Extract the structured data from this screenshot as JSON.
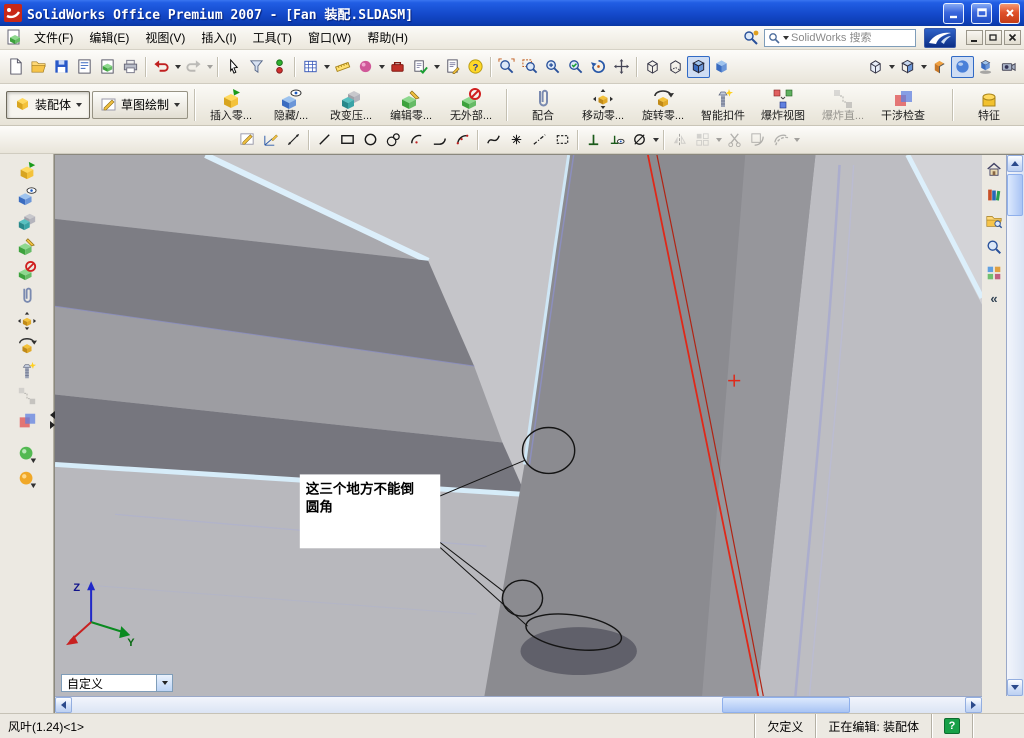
{
  "titlebar": {
    "title": "SolidWorks Office Premium 2007 - [Fan 装配.SLDASM]"
  },
  "menubar": {
    "items": [
      "文件(F)",
      "编辑(E)",
      "视图(V)",
      "插入(I)",
      "工具(T)",
      "窗口(W)",
      "帮助(H)"
    ],
    "search_placeholder": "SolidWorks 搜索"
  },
  "toolbar_standard": {
    "icons": [
      "new-document",
      "open",
      "save",
      "make-drawing",
      "make-assembly",
      "print",
      "undo",
      "redo",
      "select",
      "selection-filter",
      "toggle-selection-filters",
      "design-binder",
      "measure",
      "appearance",
      "toolbox",
      "design-checker",
      "report",
      "help",
      "zoom-to-fit",
      "zoom-to-area",
      "zoom-in-out",
      "zoom-to-selection",
      "rotate-view",
      "pan",
      "wireframe",
      "hidden-lines",
      "shaded-with-edges",
      "shaded",
      "standard-views",
      "display-style",
      "section-view",
      "realview",
      "shadows",
      "camera-views"
    ]
  },
  "commandmanager": {
    "tabs": [
      {
        "label": "装配体"
      },
      {
        "label": "草图绘制"
      }
    ],
    "buttons": [
      {
        "label": "插入零...",
        "icon": "insert-component"
      },
      {
        "label": "隐藏/...",
        "icon": "hide-show-components"
      },
      {
        "label": "改变压...",
        "icon": "change-suppression"
      },
      {
        "label": "编辑零...",
        "icon": "edit-part"
      },
      {
        "label": "无外部...",
        "icon": "no-external-references"
      },
      {
        "label": "配合",
        "icon": "mate"
      },
      {
        "label": "移动零...",
        "icon": "move-component"
      },
      {
        "label": "旋转零...",
        "icon": "rotate-component"
      },
      {
        "label": "智能扣件",
        "icon": "smart-fasteners"
      },
      {
        "label": "爆炸视图",
        "icon": "exploded-view"
      },
      {
        "label": "爆炸直...",
        "icon": "explode-line-sketch",
        "disabled": true
      },
      {
        "label": "干涉检查",
        "icon": "interference-detection"
      },
      {
        "label": "特征",
        "icon": "features"
      }
    ]
  },
  "toolbar_sketch": {
    "icons": [
      "sketch",
      "3d-sketch",
      "smart-dimension",
      "line",
      "rectangle",
      "circle",
      "perimeter-circle",
      "centerpoint-arc",
      "tangent-arc",
      "3point-arc",
      "spline",
      "point",
      "centerline",
      "construction-geometry",
      "add-relation",
      "display-relations",
      "dimension-diameter",
      "mirror-entities",
      "linear-pattern",
      "trim-entities",
      "convert-entities",
      "offset-entities"
    ]
  },
  "left_toolbar": {
    "icons": [
      "insert-component",
      "hide-show-components",
      "change-suppression",
      "edit-part",
      "no-external-references",
      "mate",
      "move-component",
      "rotate-component",
      "smart-fasteners",
      "explode-line-sketch",
      "interference-detection",
      "assembly-transparency",
      "physical-simulation"
    ]
  },
  "task_pane": {
    "icons": [
      "solidworks-resources",
      "design-library",
      "file-explorer",
      "search",
      "view-palette"
    ],
    "collapse_glyph": "«"
  },
  "viewport": {
    "annotation": {
      "line1": "这三个地方不能倒",
      "line2": "圆角"
    },
    "view_selector": "自定义",
    "triad": {
      "z": "Z",
      "y": "Y"
    }
  },
  "statusbar": {
    "selection": "风叶(1.24)<1>",
    "state": "欠定义",
    "editing": "正在编辑: 装配体",
    "help": "?"
  }
}
